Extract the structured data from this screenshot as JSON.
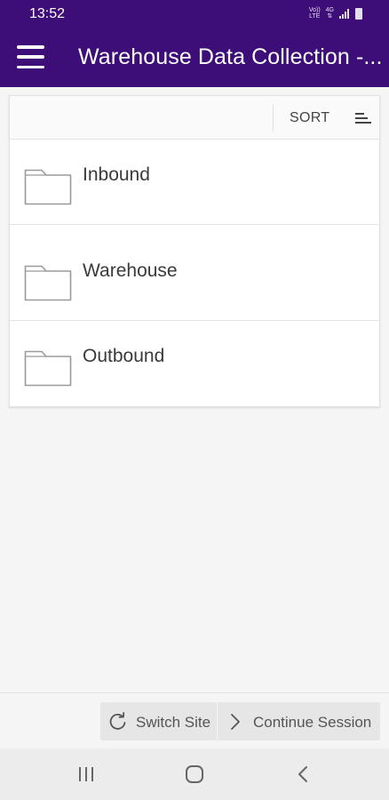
{
  "status_bar": {
    "time": "13:52",
    "volte_line1": "Vo))",
    "volte_line2": "LTE",
    "network": "4G"
  },
  "app_bar": {
    "title": "Warehouse Data Collection -..."
  },
  "toolbar": {
    "sort_label": "SORT"
  },
  "folders": [
    {
      "label": "Inbound",
      "icon": "folder-icon"
    },
    {
      "label": "Warehouse",
      "icon": "folder-icon"
    },
    {
      "label": "Outbound",
      "icon": "folder-icon"
    }
  ],
  "actions": {
    "switch_site_label": "Switch Site",
    "continue_session_label": "Continue Session"
  },
  "nav": {
    "recents_icon": "recents-icon",
    "home_icon": "home-icon",
    "back_icon": "back-icon"
  },
  "colors": {
    "brand": "#3e0e78",
    "background": "#f5f5f5",
    "action_bar": "#e6e6e6"
  }
}
